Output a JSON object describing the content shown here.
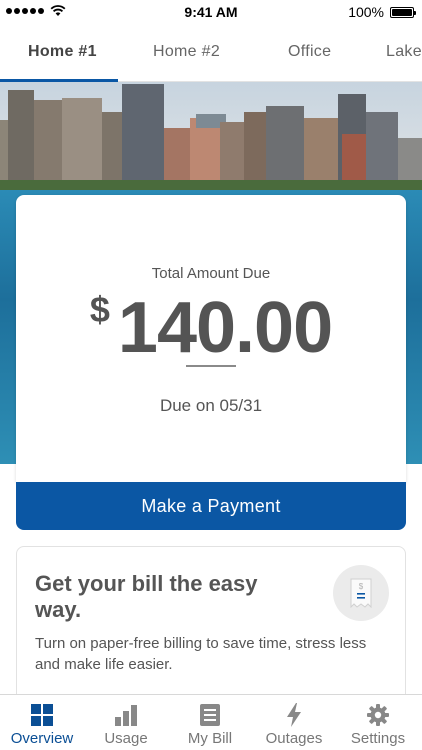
{
  "status_bar": {
    "time": "9:41 AM",
    "battery_text": "100%",
    "battery_level": 1.0
  },
  "tabs": [
    {
      "label": "Home #1",
      "active": true
    },
    {
      "label": "Home #2",
      "active": false
    },
    {
      "label": "Office",
      "active": false
    },
    {
      "label": "Lake",
      "active": false
    }
  ],
  "bill": {
    "label": "Total Amount Due",
    "currency": "$",
    "amount": "140.00",
    "due": "Due on 05/31"
  },
  "pay_button": {
    "label": "Make a Payment"
  },
  "promo": {
    "title": "Get your bill the easy way.",
    "body": "Turn on paper-free billing to save time, stress less and make life easier.",
    "icon": "paperless-bill-icon"
  },
  "bottom_nav": [
    {
      "label": "Overview",
      "icon": "grid-icon",
      "active": true
    },
    {
      "label": "Usage",
      "icon": "bar-chart-icon",
      "active": false
    },
    {
      "label": "My Bill",
      "icon": "document-icon",
      "active": false
    },
    {
      "label": "Outages",
      "icon": "lightning-icon",
      "active": false
    },
    {
      "label": "Settings",
      "icon": "gear-icon",
      "active": false
    }
  ],
  "colors": {
    "accent": "#0b57a4",
    "active_nav": "#0b4f95",
    "text": "#555555"
  }
}
